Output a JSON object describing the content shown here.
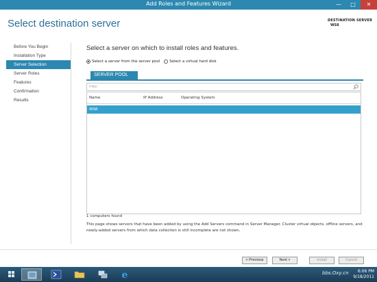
{
  "window": {
    "title": "Add Roles and Features Wizard",
    "min_glyph": "—",
    "max_glyph": "□",
    "close_glyph": "✕"
  },
  "header": {
    "page_title": "Select destination server",
    "destination_label": "DESTINATION SERVER",
    "destination_value": "WS8"
  },
  "sidebar": {
    "items": [
      {
        "label": "Before You Begin"
      },
      {
        "label": "Installation Type"
      },
      {
        "label": "Server Selection"
      },
      {
        "label": "Server Roles"
      },
      {
        "label": "Features"
      },
      {
        "label": "Confirmation"
      },
      {
        "label": "Results"
      }
    ],
    "active_index": 2
  },
  "main": {
    "heading": "Select a server on which to install roles and features.",
    "options": [
      {
        "label": "Select a server from the server pool",
        "checked": true
      },
      {
        "label": "Select a virtual hard disk",
        "checked": false
      }
    ],
    "pool_tab": "SERVER POOL",
    "filter_placeholder": "Filter",
    "columns": [
      "Name",
      "IP Address",
      "Operating System"
    ],
    "rows": [
      {
        "name": "WS8",
        "ip": "",
        "os": ""
      }
    ],
    "count_text": "1 computers found",
    "description": "This page shows servers that have been added by using the Add Servers command in Server Manager. Cluster virtual objects, offline servers, and newly-added servers from which data collection is still incomplete are not shown."
  },
  "footer": {
    "previous": "< Previous",
    "next": "Next >",
    "install": "Install",
    "cancel": "Cancel"
  },
  "taskbar": {
    "time": "6:06 PM",
    "date": "9/18/2011",
    "watermark": "bbs.Oxy.cn"
  },
  "colors": {
    "accent": "#2c88b0",
    "selected_row": "#35a0cc",
    "title_text": "#2a6f99"
  }
}
